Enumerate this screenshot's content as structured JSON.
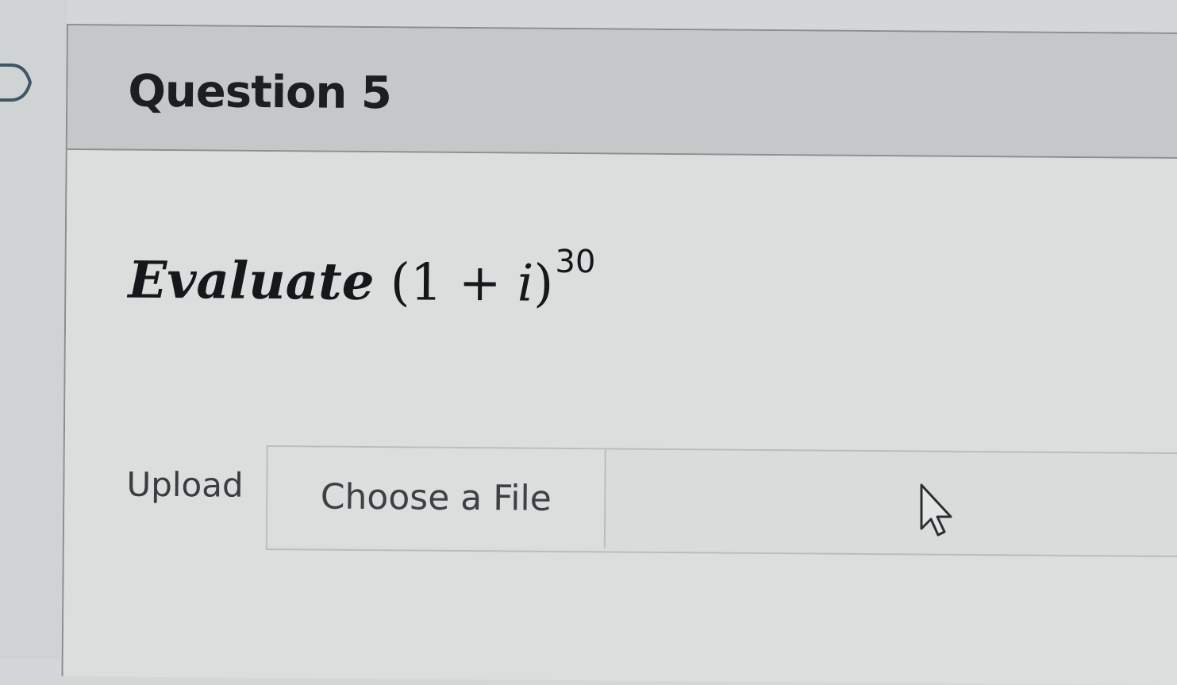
{
  "question": {
    "title": "Question 5",
    "prompt": {
      "word": "Evaluate",
      "open": "(1 + ",
      "variable": "i",
      "close": ")",
      "exponent": "30"
    }
  },
  "upload": {
    "label": "Upload",
    "button_label": "Choose a File"
  },
  "icons": {
    "collapse": "chevron-right-icon",
    "pointer": "mouse-cursor-icon"
  },
  "colors": {
    "header_bg": "#c4c8c9",
    "body_bg": "#dcdede",
    "text": "#1c1f22",
    "border": "#8c9091"
  }
}
